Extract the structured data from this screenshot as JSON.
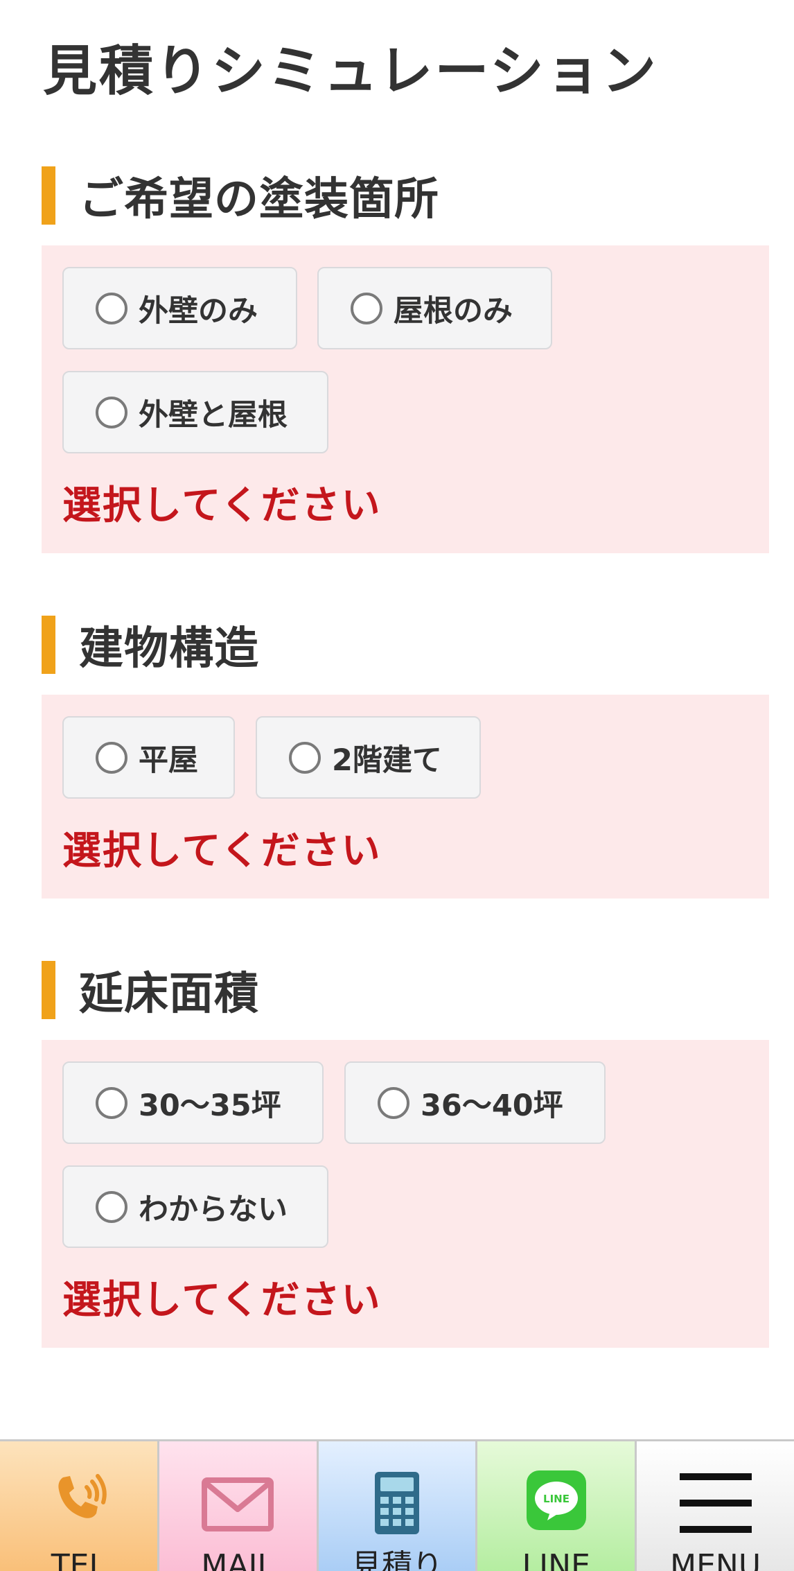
{
  "page": {
    "title": "見積りシミュレーション"
  },
  "sections": [
    {
      "heading": "ご希望の塗装箇所",
      "options": [
        "外壁のみ",
        "屋根のみ",
        "外壁と屋根"
      ],
      "error": "選択してください"
    },
    {
      "heading": "建物構造",
      "options": [
        "平屋",
        "2階建て"
      ],
      "error": "選択してください"
    },
    {
      "heading": "延床面積",
      "options": [
        "30〜35坪",
        "36〜40坪",
        "わからない"
      ],
      "error": "選択してください"
    }
  ],
  "bottom_nav": {
    "tel": "TEL",
    "mail": "MAIL",
    "estimate": "見積り",
    "line": "LINE",
    "line_badge": "LINE",
    "menu": "MENU"
  },
  "colors": {
    "accent_bar": "#f0a21a",
    "panel_bg": "#fde9ea",
    "error_text": "#c4161c"
  },
  "icons": {
    "tel": "phone-icon",
    "mail": "mail-icon",
    "estimate": "calculator-icon",
    "line": "line-icon",
    "menu": "hamburger-icon"
  }
}
